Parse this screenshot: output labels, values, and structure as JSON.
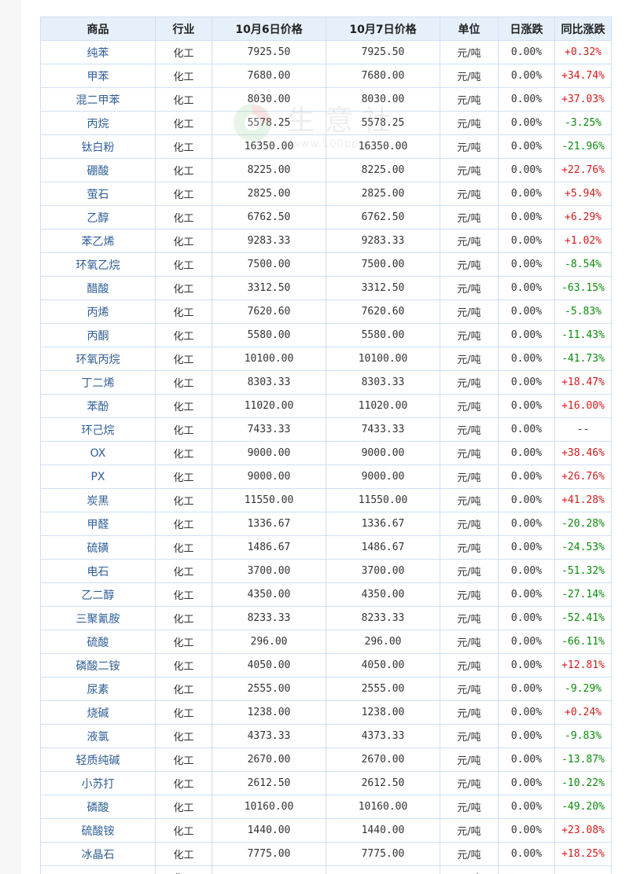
{
  "table": {
    "headers": [
      "商品",
      "行业",
      "10月6日价格",
      "10月7日价格",
      "单位",
      "日涨跌",
      "同比涨跌"
    ],
    "rows": [
      {
        "name": "纯苯",
        "industry": "化工",
        "p1": "7925.50",
        "p2": "7925.50",
        "unit": "元/吨",
        "daily": "0.00%",
        "yoy": "+0.32%",
        "dir": "up"
      },
      {
        "name": "甲苯",
        "industry": "化工",
        "p1": "7680.00",
        "p2": "7680.00",
        "unit": "元/吨",
        "daily": "0.00%",
        "yoy": "+34.74%",
        "dir": "up"
      },
      {
        "name": "混二甲苯",
        "industry": "化工",
        "p1": "8030.00",
        "p2": "8030.00",
        "unit": "元/吨",
        "daily": "0.00%",
        "yoy": "+37.03%",
        "dir": "up"
      },
      {
        "name": "丙烷",
        "industry": "化工",
        "p1": "5578.25",
        "p2": "5578.25",
        "unit": "元/吨",
        "daily": "0.00%",
        "yoy": "-3.25%",
        "dir": "down"
      },
      {
        "name": "钛白粉",
        "industry": "化工",
        "p1": "16350.00",
        "p2": "16350.00",
        "unit": "元/吨",
        "daily": "0.00%",
        "yoy": "-21.96%",
        "dir": "down"
      },
      {
        "name": "硼酸",
        "industry": "化工",
        "p1": "8225.00",
        "p2": "8225.00",
        "unit": "元/吨",
        "daily": "0.00%",
        "yoy": "+22.76%",
        "dir": "up"
      },
      {
        "name": "萤石",
        "industry": "化工",
        "p1": "2825.00",
        "p2": "2825.00",
        "unit": "元/吨",
        "daily": "0.00%",
        "yoy": "+5.94%",
        "dir": "up"
      },
      {
        "name": "乙醇",
        "industry": "化工",
        "p1": "6762.50",
        "p2": "6762.50",
        "unit": "元/吨",
        "daily": "0.00%",
        "yoy": "+6.29%",
        "dir": "up"
      },
      {
        "name": "苯乙烯",
        "industry": "化工",
        "p1": "9283.33",
        "p2": "9283.33",
        "unit": "元/吨",
        "daily": "0.00%",
        "yoy": "+1.02%",
        "dir": "up"
      },
      {
        "name": "环氧乙烷",
        "industry": "化工",
        "p1": "7500.00",
        "p2": "7500.00",
        "unit": "元/吨",
        "daily": "0.00%",
        "yoy": "-8.54%",
        "dir": "down"
      },
      {
        "name": "醋酸",
        "industry": "化工",
        "p1": "3312.50",
        "p2": "3312.50",
        "unit": "元/吨",
        "daily": "0.00%",
        "yoy": "-63.15%",
        "dir": "down"
      },
      {
        "name": "丙烯",
        "industry": "化工",
        "p1": "7620.60",
        "p2": "7620.60",
        "unit": "元/吨",
        "daily": "0.00%",
        "yoy": "-5.83%",
        "dir": "down"
      },
      {
        "name": "丙酮",
        "industry": "化工",
        "p1": "5580.00",
        "p2": "5580.00",
        "unit": "元/吨",
        "daily": "0.00%",
        "yoy": "-11.43%",
        "dir": "down"
      },
      {
        "name": "环氧丙烷",
        "industry": "化工",
        "p1": "10100.00",
        "p2": "10100.00",
        "unit": "元/吨",
        "daily": "0.00%",
        "yoy": "-41.73%",
        "dir": "down"
      },
      {
        "name": "丁二烯",
        "industry": "化工",
        "p1": "8303.33",
        "p2": "8303.33",
        "unit": "元/吨",
        "daily": "0.00%",
        "yoy": "+18.47%",
        "dir": "up"
      },
      {
        "name": "苯酚",
        "industry": "化工",
        "p1": "11020.00",
        "p2": "11020.00",
        "unit": "元/吨",
        "daily": "0.00%",
        "yoy": "+16.00%",
        "dir": "up"
      },
      {
        "name": "环己烷",
        "industry": "化工",
        "p1": "7433.33",
        "p2": "7433.33",
        "unit": "元/吨",
        "daily": "0.00%",
        "yoy": "--",
        "dir": "flat"
      },
      {
        "name": "OX",
        "industry": "化工",
        "p1": "9000.00",
        "p2": "9000.00",
        "unit": "元/吨",
        "daily": "0.00%",
        "yoy": "+38.46%",
        "dir": "up"
      },
      {
        "name": "PX",
        "industry": "化工",
        "p1": "9000.00",
        "p2": "9000.00",
        "unit": "元/吨",
        "daily": "0.00%",
        "yoy": "+26.76%",
        "dir": "up"
      },
      {
        "name": "炭黑",
        "industry": "化工",
        "p1": "11550.00",
        "p2": "11550.00",
        "unit": "元/吨",
        "daily": "0.00%",
        "yoy": "+41.28%",
        "dir": "up"
      },
      {
        "name": "甲醛",
        "industry": "化工",
        "p1": "1336.67",
        "p2": "1336.67",
        "unit": "元/吨",
        "daily": "0.00%",
        "yoy": "-20.28%",
        "dir": "down"
      },
      {
        "name": "硫磺",
        "industry": "化工",
        "p1": "1486.67",
        "p2": "1486.67",
        "unit": "元/吨",
        "daily": "0.00%",
        "yoy": "-24.53%",
        "dir": "down"
      },
      {
        "name": "电石",
        "industry": "化工",
        "p1": "3700.00",
        "p2": "3700.00",
        "unit": "元/吨",
        "daily": "0.00%",
        "yoy": "-51.32%",
        "dir": "down"
      },
      {
        "name": "乙二醇",
        "industry": "化工",
        "p1": "4350.00",
        "p2": "4350.00",
        "unit": "元/吨",
        "daily": "0.00%",
        "yoy": "-27.14%",
        "dir": "down"
      },
      {
        "name": "三聚氰胺",
        "industry": "化工",
        "p1": "8233.33",
        "p2": "8233.33",
        "unit": "元/吨",
        "daily": "0.00%",
        "yoy": "-52.41%",
        "dir": "down"
      },
      {
        "name": "硫酸",
        "industry": "化工",
        "p1": "296.00",
        "p2": "296.00",
        "unit": "元/吨",
        "daily": "0.00%",
        "yoy": "-66.11%",
        "dir": "down"
      },
      {
        "name": "磷酸二铵",
        "industry": "化工",
        "p1": "4050.00",
        "p2": "4050.00",
        "unit": "元/吨",
        "daily": "0.00%",
        "yoy": "+12.81%",
        "dir": "up"
      },
      {
        "name": "尿素",
        "industry": "化工",
        "p1": "2555.00",
        "p2": "2555.00",
        "unit": "元/吨",
        "daily": "0.00%",
        "yoy": "-9.29%",
        "dir": "down"
      },
      {
        "name": "烧碱",
        "industry": "化工",
        "p1": "1238.00",
        "p2": "1238.00",
        "unit": "元/吨",
        "daily": "0.00%",
        "yoy": "+0.24%",
        "dir": "up"
      },
      {
        "name": "液氯",
        "industry": "化工",
        "p1": "4373.33",
        "p2": "4373.33",
        "unit": "元/吨",
        "daily": "0.00%",
        "yoy": "-9.83%",
        "dir": "down"
      },
      {
        "name": "轻质纯碱",
        "industry": "化工",
        "p1": "2670.00",
        "p2": "2670.00",
        "unit": "元/吨",
        "daily": "0.00%",
        "yoy": "-13.87%",
        "dir": "down"
      },
      {
        "name": "小苏打",
        "industry": "化工",
        "p1": "2612.50",
        "p2": "2612.50",
        "unit": "元/吨",
        "daily": "0.00%",
        "yoy": "-10.22%",
        "dir": "down"
      },
      {
        "name": "磷酸",
        "industry": "化工",
        "p1": "10160.00",
        "p2": "10160.00",
        "unit": "元/吨",
        "daily": "0.00%",
        "yoy": "-49.20%",
        "dir": "down"
      },
      {
        "name": "硫酸铵",
        "industry": "化工",
        "p1": "1440.00",
        "p2": "1440.00",
        "unit": "元/吨",
        "daily": "0.00%",
        "yoy": "+23.08%",
        "dir": "up"
      },
      {
        "name": "冰晶石",
        "industry": "化工",
        "p1": "7775.00",
        "p2": "7775.00",
        "unit": "元/吨",
        "daily": "0.00%",
        "yoy": "+18.25%",
        "dir": "up"
      }
    ],
    "partial_row": {
      "name": "",
      "industry": "化工",
      "p1": "",
      "p2": "",
      "unit": "元/吨",
      "daily": "",
      "yoy": ""
    }
  },
  "watermark": {
    "text": "生意社",
    "sub": "www.100ppi.com"
  },
  "colors": {
    "up": "#d21b1b",
    "down": "#0a8a0a",
    "header_bg": "#e6f0fb",
    "border": "#cfe0f3",
    "link": "#2f5e95"
  }
}
